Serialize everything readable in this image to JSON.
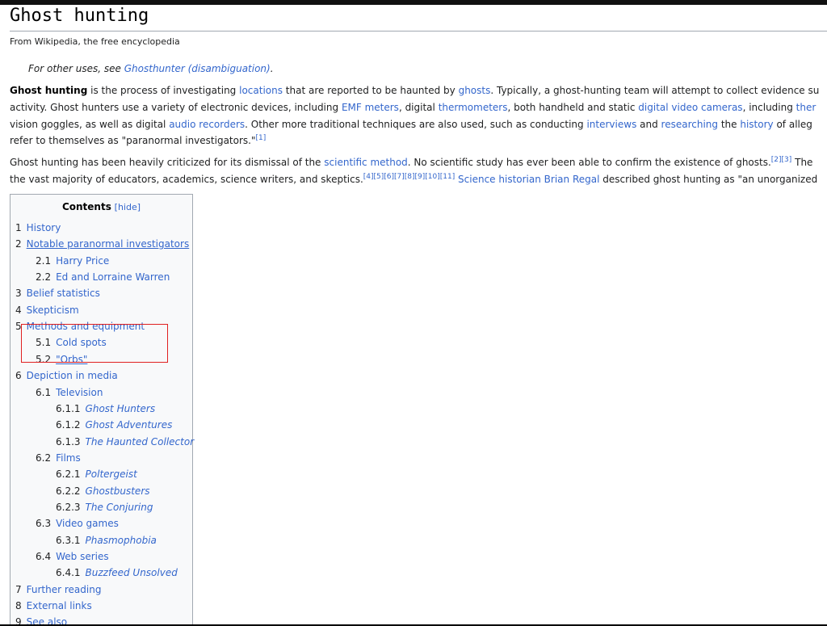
{
  "article": {
    "title": "Ghost hunting",
    "tagline": "From Wikipedia, the free encyclopedia",
    "hatnote_prefix": "For other uses, see ",
    "hatnote_link": "Ghosthunter (disambiguation)",
    "hatnote_suffix": "."
  },
  "para1": {
    "l1": [
      "Ghost hunting",
      " is the process of investigating ",
      "locations",
      " that are reported to be haunted by ",
      "ghosts",
      ". Typically, a ghost-hunting team will attempt to collect evidence su"
    ],
    "l2": [
      "activity. Ghost hunters use a variety of electronic devices, including ",
      "EMF meters",
      ", digital ",
      "thermometers",
      ", both handheld and static ",
      "digital video cameras",
      ", including ",
      "ther"
    ],
    "l3": [
      "vision goggles, as well as digital ",
      "audio recorders",
      ". Other more traditional techniques are also used, such as conducting ",
      "interviews",
      " and ",
      "researching",
      " the ",
      "history",
      " of alleg"
    ],
    "l4": [
      "refer to themselves as \"paranormal investigators.\"",
      "[1]"
    ]
  },
  "para2": {
    "l1": [
      "Ghost hunting has been heavily criticized for its dismissal of the ",
      "scientific method",
      ". No scientific study has ever been able to confirm the existence of ghosts.",
      "[2][3]",
      " The"
    ],
    "l2": [
      "the vast majority of educators, academics, science writers, and skeptics.",
      "[4][5][6][7][8][9][10][11]",
      " ",
      "Science historian",
      " ",
      "Brian Regal",
      " described ghost hunting as \"an unorganized"
    ]
  },
  "toc": {
    "title": "Contents",
    "hide": "[hide]",
    "items": [
      {
        "num": "1",
        "text": "History",
        "level": 1
      },
      {
        "num": "2",
        "text": "Notable paranormal investigators",
        "level": 1
      },
      {
        "num": "2.1",
        "text": "Harry Price",
        "level": 2
      },
      {
        "num": "2.2",
        "text": "Ed and Lorraine Warren",
        "level": 2
      },
      {
        "num": "3",
        "text": "Belief statistics",
        "level": 1
      },
      {
        "num": "4",
        "text": "Skepticism",
        "level": 1
      },
      {
        "num": "5",
        "text": "Methods and equipment",
        "level": 1
      },
      {
        "num": "5.1",
        "text": "Cold spots",
        "level": 2
      },
      {
        "num": "5.2",
        "text": "\"Orbs\"",
        "level": 2
      },
      {
        "num": "6",
        "text": "Depiction in media",
        "level": 1
      },
      {
        "num": "6.1",
        "text": "Television",
        "level": 2
      },
      {
        "num": "6.1.1",
        "text": "Ghost Hunters",
        "level": 3
      },
      {
        "num": "6.1.2",
        "text": "Ghost Adventures",
        "level": 3
      },
      {
        "num": "6.1.3",
        "text": "The Haunted Collector",
        "level": 3
      },
      {
        "num": "6.2",
        "text": "Films",
        "level": 2
      },
      {
        "num": "6.2.1",
        "text": "Poltergeist",
        "level": 3
      },
      {
        "num": "6.2.2",
        "text": "Ghostbusters",
        "level": 3
      },
      {
        "num": "6.2.3",
        "text": "The Conjuring",
        "level": 3
      },
      {
        "num": "6.3",
        "text": "Video games",
        "level": 2
      },
      {
        "num": "6.3.1",
        "text": "Phasmophobia",
        "level": 3
      },
      {
        "num": "6.4",
        "text": "Web series",
        "level": 2
      },
      {
        "num": "6.4.1",
        "text": "Buzzfeed Unsolved",
        "level": 3
      },
      {
        "num": "7",
        "text": "Further reading",
        "level": 1
      },
      {
        "num": "8",
        "text": "External links",
        "level": 1
      },
      {
        "num": "9",
        "text": "See also",
        "level": 1
      }
    ]
  },
  "colors": {
    "link": "#3366cc",
    "highlight_box": "#e02020",
    "toc_bg": "#f8f9fa"
  }
}
